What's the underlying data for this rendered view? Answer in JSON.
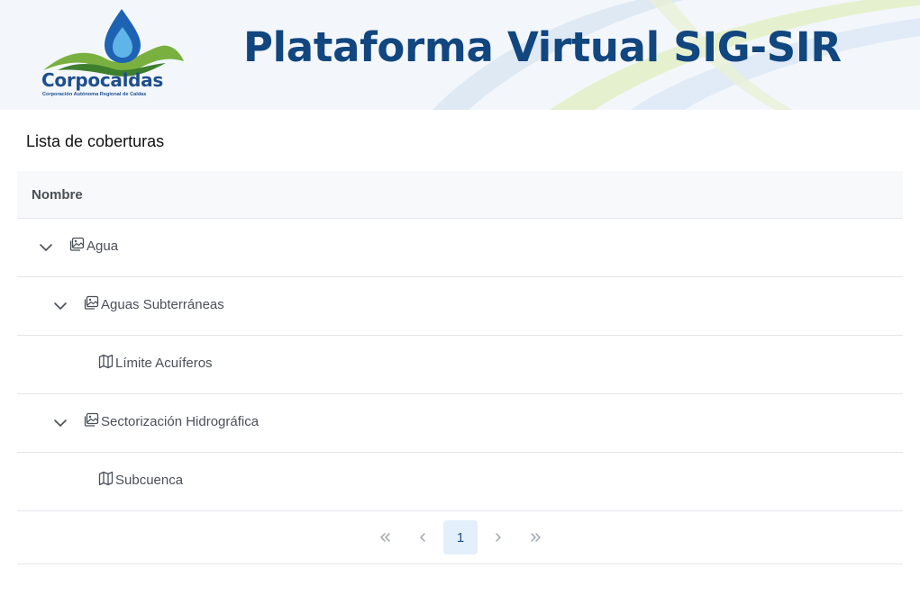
{
  "header": {
    "logo_name": "Corpocaldas",
    "logo_subtitle": "Corporación Autónoma Regional de Caldas",
    "title": "Plataforma Virtual SIG-SIR"
  },
  "list": {
    "title": "Lista de coberturas",
    "column_header": "Nombre",
    "rows": [
      {
        "label": "Agua",
        "type": "group",
        "expanded": true,
        "level": 0,
        "icon": "image-icon"
      },
      {
        "label": "Aguas Subterráneas",
        "type": "group",
        "expanded": true,
        "level": 1,
        "icon": "image-icon"
      },
      {
        "label": "Límite Acuíferos",
        "type": "layer",
        "level": 2,
        "icon": "map-icon"
      },
      {
        "label": "Sectorización Hidrográfica",
        "type": "group",
        "expanded": true,
        "level": 1,
        "icon": "image-icon"
      },
      {
        "label": "Subcuenca",
        "type": "layer",
        "level": 2,
        "icon": "map-icon"
      }
    ]
  },
  "pagination": {
    "first_icon": "double-chevron-left-icon",
    "prev_icon": "chevron-left-icon",
    "current_page": "1",
    "next_icon": "chevron-right-icon",
    "last_icon": "double-chevron-right-icon"
  },
  "colors": {
    "title_blue": "#11467f",
    "header_bg": "#f3f7fb",
    "active_page_bg": "#e3f0fb"
  }
}
